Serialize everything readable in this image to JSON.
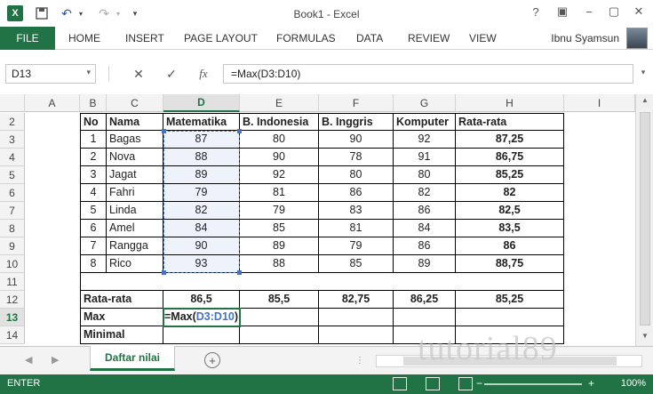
{
  "window": {
    "title": "Book1 - Excel"
  },
  "ribbon": {
    "file": "FILE",
    "tabs": [
      "HOME",
      "INSERT",
      "PAGE LAYOUT",
      "FORMULAS",
      "DATA",
      "REVIEW",
      "VIEW"
    ],
    "user": "Ibnu Syamsun"
  },
  "formula_bar": {
    "name_box": "D13",
    "formula": "=Max(D3:D10)",
    "fx": "fx"
  },
  "columns": [
    "A",
    "B",
    "C",
    "D",
    "E",
    "F",
    "G",
    "H",
    "I"
  ],
  "rows": [
    "2",
    "3",
    "4",
    "5",
    "6",
    "7",
    "8",
    "9",
    "10",
    "11",
    "12",
    "13",
    "14"
  ],
  "table": {
    "headers": [
      "No",
      "Nama",
      "Matematika",
      "B. Indonesia",
      "B. Inggris",
      "Komputer",
      "Rata-rata"
    ],
    "data": [
      [
        "1",
        "Bagas",
        "87",
        "80",
        "90",
        "92",
        "87,25"
      ],
      [
        "2",
        "Nova",
        "88",
        "90",
        "78",
        "91",
        "86,75"
      ],
      [
        "3",
        "Jagat",
        "89",
        "92",
        "80",
        "80",
        "85,25"
      ],
      [
        "4",
        "Fahri",
        "79",
        "81",
        "86",
        "82",
        "82"
      ],
      [
        "5",
        "Linda",
        "82",
        "79",
        "83",
        "86",
        "82,5"
      ],
      [
        "6",
        "Amel",
        "84",
        "85",
        "81",
        "84",
        "83,5"
      ],
      [
        "7",
        "Rangga",
        "90",
        "89",
        "79",
        "86",
        "86"
      ],
      [
        "8",
        "Rico",
        "93",
        "88",
        "85",
        "89",
        "88,75"
      ]
    ],
    "summary": {
      "rata_label": "Rata-rata",
      "rata_values": [
        "86,5",
        "85,5",
        "82,75",
        "86,25",
        "85,25"
      ],
      "max_label": "Max",
      "max_formula_prefix": "=Max(",
      "max_formula_ref": "D3:D10",
      "max_formula_suffix": ")",
      "min_label": "Minimal"
    }
  },
  "sheets": {
    "active": "Daftar nilai",
    "add": "+"
  },
  "status": {
    "mode": "ENTER",
    "zoom": "100%"
  },
  "watermark": "tutorial89"
}
